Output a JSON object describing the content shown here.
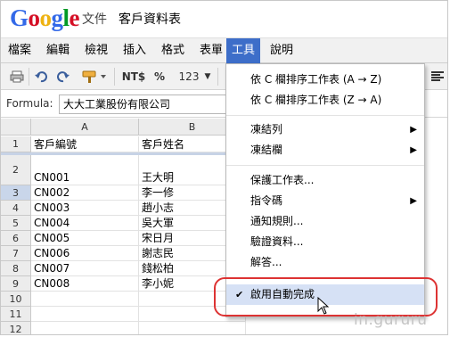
{
  "app": {
    "logo_letters": [
      {
        "ch": "G",
        "color": "#3369e8"
      },
      {
        "ch": "o",
        "color": "#d50f25"
      },
      {
        "ch": "o",
        "color": "#eeb211"
      },
      {
        "ch": "g",
        "color": "#3369e8"
      },
      {
        "ch": "l",
        "color": "#009925"
      },
      {
        "ch": "e",
        "color": "#d50f25"
      }
    ],
    "product": "文件",
    "doc_title": "客戶資料表"
  },
  "menubar": {
    "items": [
      "檔案",
      "編輯",
      "檢視",
      "插入",
      "格式",
      "表單",
      "工具",
      "說明"
    ],
    "active": "工具",
    "accent": "#3d6ec9"
  },
  "toolbar": {
    "currency": "NT$",
    "percent": "%",
    "number_format": "123",
    "icons": [
      "print-icon",
      "undo-icon",
      "redo-icon",
      "paint-format-icon",
      "align-icon"
    ]
  },
  "formula": {
    "label": "Formula:",
    "value": "大大工業股份有限公司"
  },
  "grid": {
    "columns": [
      "A",
      "B"
    ],
    "rows": [
      {
        "num": "1",
        "a": "客戶編號",
        "b": "客戶姓名"
      },
      {
        "num": "2",
        "a": "CN001",
        "b": "王大明"
      },
      {
        "num": "3",
        "a": "CN002",
        "b": "李一修"
      },
      {
        "num": "4",
        "a": "CN003",
        "b": "趙小志"
      },
      {
        "num": "5",
        "a": "CN004",
        "b": "吳大軍"
      },
      {
        "num": "6",
        "a": "CN005",
        "b": "宋日月"
      },
      {
        "num": "7",
        "a": "CN006",
        "b": "謝志民"
      },
      {
        "num": "8",
        "a": "CN007",
        "b": "錢松柏"
      },
      {
        "num": "9",
        "a": "CN008",
        "b": "李小妮"
      },
      {
        "num": "10",
        "a": "",
        "b": ""
      },
      {
        "num": "11",
        "a": "",
        "b": ""
      },
      {
        "num": "12",
        "a": "",
        "b": ""
      }
    ]
  },
  "tools_menu": {
    "items": [
      {
        "label": "依 C 欄排序工作表 (A → Z)",
        "submenu": false
      },
      {
        "label": "依 C 欄排序工作表 (Z → A)",
        "submenu": false
      },
      {
        "label": "凍結列",
        "submenu": true
      },
      {
        "label": "凍結欄",
        "submenu": true
      },
      {
        "label": "保護工作表...",
        "submenu": false
      },
      {
        "label": "指令碼",
        "submenu": true
      },
      {
        "label": "通知規則...",
        "submenu": false
      },
      {
        "label": "驗證資料...",
        "submenu": false
      },
      {
        "label": "解答...",
        "submenu": false
      },
      {
        "label": "啟用自動完成",
        "submenu": false,
        "checked": true
      }
    ]
  },
  "watermark": "in.gururu"
}
